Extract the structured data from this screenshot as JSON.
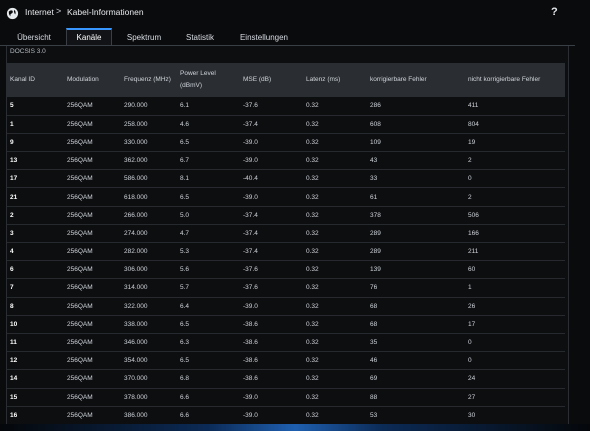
{
  "header": {
    "breadcrumb_home": "Internet",
    "breadcrumb_separator": ">",
    "breadcrumb_page": "Kabel-Informationen",
    "help": "?"
  },
  "tabs": [
    {
      "label": "Übersicht",
      "active": false
    },
    {
      "label": "Kanäle",
      "active": true
    },
    {
      "label": "Spektrum",
      "active": false
    },
    {
      "label": "Statistik",
      "active": false
    },
    {
      "label": "Einstellungen",
      "active": false
    }
  ],
  "section_title": "DOCSIS 3.0",
  "table": {
    "headers": [
      "Kanal ID",
      "Modulation",
      "Frequenz (MHz)",
      "Power Level\n(dBmV)",
      "MSE (dB)",
      "Latenz (ms)",
      "korrigierbare Fehler",
      "nicht korrigierbare Fehler"
    ],
    "rows": [
      [
        "5",
        "256QAM",
        "290.000",
        "6.1",
        "-37.6",
        "0.32",
        "286",
        "411"
      ],
      [
        "1",
        "256QAM",
        "258.000",
        "4.6",
        "-37.4",
        "0.32",
        "608",
        "804"
      ],
      [
        "9",
        "256QAM",
        "330.000",
        "6.5",
        "-39.0",
        "0.32",
        "109",
        "19"
      ],
      [
        "13",
        "256QAM",
        "362.000",
        "6.7",
        "-39.0",
        "0.32",
        "43",
        "2"
      ],
      [
        "17",
        "256QAM",
        "586.000",
        "8.1",
        "-40.4",
        "0.32",
        "33",
        "0"
      ],
      [
        "21",
        "256QAM",
        "618.000",
        "6.5",
        "-39.0",
        "0.32",
        "61",
        "2"
      ],
      [
        "2",
        "256QAM",
        "266.000",
        "5.0",
        "-37.4",
        "0.32",
        "378",
        "506"
      ],
      [
        "3",
        "256QAM",
        "274.000",
        "4.7",
        "-37.4",
        "0.32",
        "289",
        "166"
      ],
      [
        "4",
        "256QAM",
        "282.000",
        "5.3",
        "-37.4",
        "0.32",
        "289",
        "211"
      ],
      [
        "6",
        "256QAM",
        "306.000",
        "5.6",
        "-37.6",
        "0.32",
        "139",
        "60"
      ],
      [
        "7",
        "256QAM",
        "314.000",
        "5.7",
        "-37.6",
        "0.32",
        "76",
        "1"
      ],
      [
        "8",
        "256QAM",
        "322.000",
        "6.4",
        "-39.0",
        "0.32",
        "68",
        "26"
      ],
      [
        "10",
        "256QAM",
        "338.000",
        "6.5",
        "-38.6",
        "0.32",
        "68",
        "17"
      ],
      [
        "11",
        "256QAM",
        "346.000",
        "6.3",
        "-38.6",
        "0.32",
        "35",
        "0"
      ],
      [
        "12",
        "256QAM",
        "354.000",
        "6.5",
        "-38.6",
        "0.32",
        "46",
        "0"
      ],
      [
        "14",
        "256QAM",
        "370.000",
        "6.8",
        "-38.6",
        "0.32",
        "69",
        "24"
      ],
      [
        "15",
        "256QAM",
        "378.000",
        "6.6",
        "-39.0",
        "0.32",
        "88",
        "27"
      ],
      [
        "16",
        "256QAM",
        "386.000",
        "6.6",
        "-39.0",
        "0.32",
        "53",
        "30"
      ]
    ]
  },
  "colors": {
    "background": "#0a0b0d",
    "header_row": "#2a2e33",
    "active_tab_accent": "#3a96ff",
    "text": "#d8dde3"
  }
}
